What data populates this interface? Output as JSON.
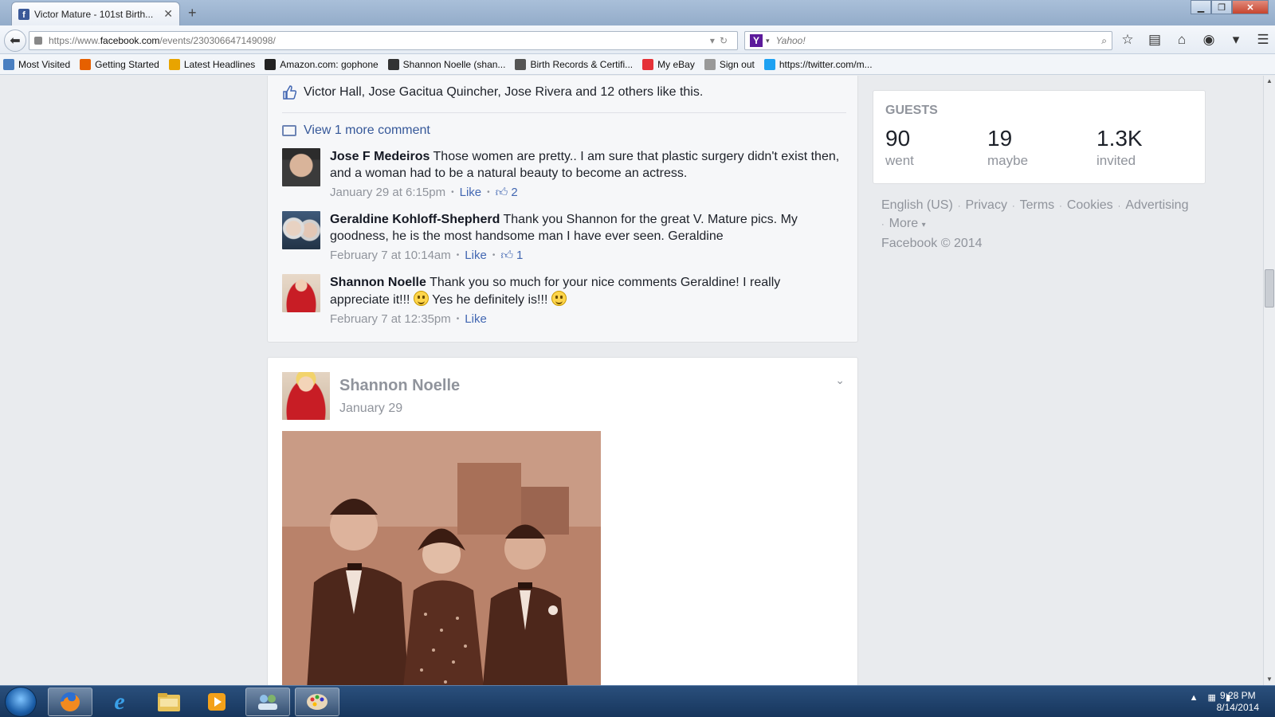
{
  "browser": {
    "tab_title": "Victor Mature - 101st Birth...",
    "url_prefix": "https://www.",
    "url_host": "facebook.com",
    "url_path": "/events/230306647149098/",
    "search_placeholder": "Yahoo!",
    "bookmarks": [
      {
        "label": "Most Visited",
        "icon": "bookmark-folder-icon",
        "color": "#4a7fc1"
      },
      {
        "label": "Getting Started",
        "icon": "firefox-icon",
        "color": "#e66000"
      },
      {
        "label": "Latest Headlines",
        "icon": "rss-icon",
        "color": "#e8a400"
      },
      {
        "label": "Amazon.com: gophone",
        "icon": "amazon-icon",
        "color": "#222222"
      },
      {
        "label": "Shannon Noelle (shan...",
        "icon": "people-icon",
        "color": "#333333"
      },
      {
        "label": "Birth Records & Certifi...",
        "icon": "rb-icon",
        "color": "#555555"
      },
      {
        "label": "My eBay",
        "icon": "ebay-icon",
        "color": "#e53238"
      },
      {
        "label": "Sign out",
        "icon": "dotted-box-icon",
        "color": "#999999"
      },
      {
        "label": "https://twitter.com/m...",
        "icon": "twitter-icon",
        "color": "#1da1f2"
      }
    ]
  },
  "comments_section": {
    "likes_text": "Victor Hall, Jose Gacitua Quincher, Jose Rivera and 12 others like this.",
    "view_more": "View 1 more comment",
    "comments": [
      {
        "author": "Jose F Medeiros",
        "text": "Those women are pretty.. I am sure that plastic surgery didn't exist then, and a woman had to be a natural beauty to become an actress.",
        "time": "January 29 at 6:15pm",
        "like_label": "Like",
        "like_count": "2"
      },
      {
        "author": "Geraldine Kohloff-Shepherd",
        "text": "Thank you Shannon for the great V. Mature pics. My goodness, he is the most handsome man I have ever seen. Geraldine",
        "time": "February 7 at 10:14am",
        "like_label": "Like",
        "like_count": "1"
      },
      {
        "author": "Shannon Noelle",
        "text_part1": "Thank you so much for your nice comments Geraldine! I really appreciate it!!!",
        "text_part2": "Yes he definitely is!!!",
        "time": "February 7 at 12:35pm",
        "like_label": "Like"
      }
    ]
  },
  "post": {
    "author": "Shannon Noelle",
    "date": "January 29"
  },
  "guests": {
    "title": "GUESTS",
    "stats": [
      {
        "value": "90",
        "label": "went"
      },
      {
        "value": "19",
        "label": "maybe"
      },
      {
        "value": "1.3K",
        "label": "invited"
      }
    ]
  },
  "footer": {
    "links": [
      "English (US)",
      "Privacy",
      "Terms",
      "Cookies",
      "Advertising"
    ],
    "more": "More",
    "copyright": "Facebook © 2014"
  },
  "taskbar": {
    "time": "9:28 PM",
    "date": "8/14/2014"
  },
  "colors": {
    "facebook_blue": "#4267b2",
    "meta_gray": "#90949c"
  }
}
